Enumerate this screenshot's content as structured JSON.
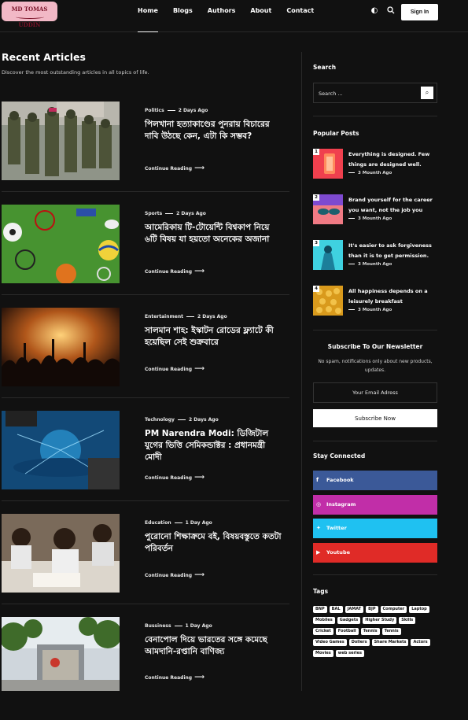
{
  "logo": {
    "text": "MD TOMAS UDDIN"
  },
  "nav": {
    "items": [
      "Home",
      "Blogs",
      "Authors",
      "About",
      "Contact"
    ],
    "signin_label": "Sign In"
  },
  "main": {
    "heading": "Recent Articles",
    "subheading": "Discover the most outstanding articles in all topics of life.",
    "continue_label": "Continue Reading",
    "articles": [
      {
        "category": "Politics",
        "date": "2 Days Ago",
        "title": "পিলখানা হত্যাকাণ্ডের পুনরায় বিচারের দাবি উঠছে কেন, এটা কি সম্ভব?"
      },
      {
        "category": "Sports",
        "date": "2 Days Ago",
        "title": "আমেরিকায় টি-টোয়েন্টি বিশ্বকাপ নিয়ে ৬টি বিষয় যা হয়তো অনেকের অজানা"
      },
      {
        "category": "Entertainment",
        "date": "2 Days Ago",
        "title": "সালমান শাহ: ইস্কাটন রোডের ফ্ল্যাটে কী হয়েছিল সেই শুক্রবারে"
      },
      {
        "category": "Technology",
        "date": "2 Days Ago",
        "title": "PM Narendra Modi: ডিজিটাল যুগের ভিত্তি সেমিকন্ডাক্টর : প্রধানমন্ত্রী মোদী"
      },
      {
        "category": "Education",
        "date": "1 Day Ago",
        "title": "পুরোনো শিক্ষাক্রমে বই, বিষয়বস্তুতে কতটা পরিবর্তন"
      },
      {
        "category": "Bussiness",
        "date": "1 Day Ago",
        "title": "বেনাপোল দিয়ে ভারতের সঙ্গে কমেছে আমদানি-রপ্তানি বাণিজ্য"
      }
    ]
  },
  "sidebar": {
    "search": {
      "heading": "Search",
      "placeholder": "Search ..."
    },
    "popular": {
      "heading": "Popular Posts",
      "posts": [
        {
          "num": "1",
          "title": "Everything is designed. Few things are designed well.",
          "date": "3 Mounth Ago"
        },
        {
          "num": "2",
          "title": "Brand yourself for the career you want, not the job you",
          "date": "3 Mounth Ago"
        },
        {
          "num": "3",
          "title": "It's easier to ask forgiveness than it is to get permission.",
          "date": "3 Mounth Ago"
        },
        {
          "num": "4",
          "title": "All happiness depends on a leisurely breakfast",
          "date": "3 Mounth Ago"
        }
      ]
    },
    "newsletter": {
      "heading": "Subscribe To Our Newsletter",
      "desc": "No spam, notifications only about new products, updates.",
      "placeholder": "Your Email Adress",
      "button": "Subscribe Now"
    },
    "social": {
      "heading": "Stay Connected",
      "items": [
        {
          "label": "Facebook",
          "icon": "facebook-icon",
          "color": "#3b5998"
        },
        {
          "label": "Instagram",
          "icon": "instagram-icon",
          "color": "#c12ea8"
        },
        {
          "label": "Twitter",
          "icon": "twitter-icon",
          "color": "#1fc1f1"
        },
        {
          "label": "Youtube",
          "icon": "youtube-icon",
          "color": "#e02b27"
        }
      ]
    },
    "tags": {
      "heading": "Tags",
      "items": [
        "BNP",
        "BAL",
        "JAMAT",
        "BJP",
        "Computer",
        "Laptop",
        "Mobiles",
        "Gadgets",
        "Higher Study",
        "Skills",
        "Cricket",
        "Football",
        "Tennis",
        "Tennis",
        "Video Games",
        "Dollers",
        "Share Markets",
        "Actors",
        "Movies",
        "web series"
      ]
    }
  }
}
